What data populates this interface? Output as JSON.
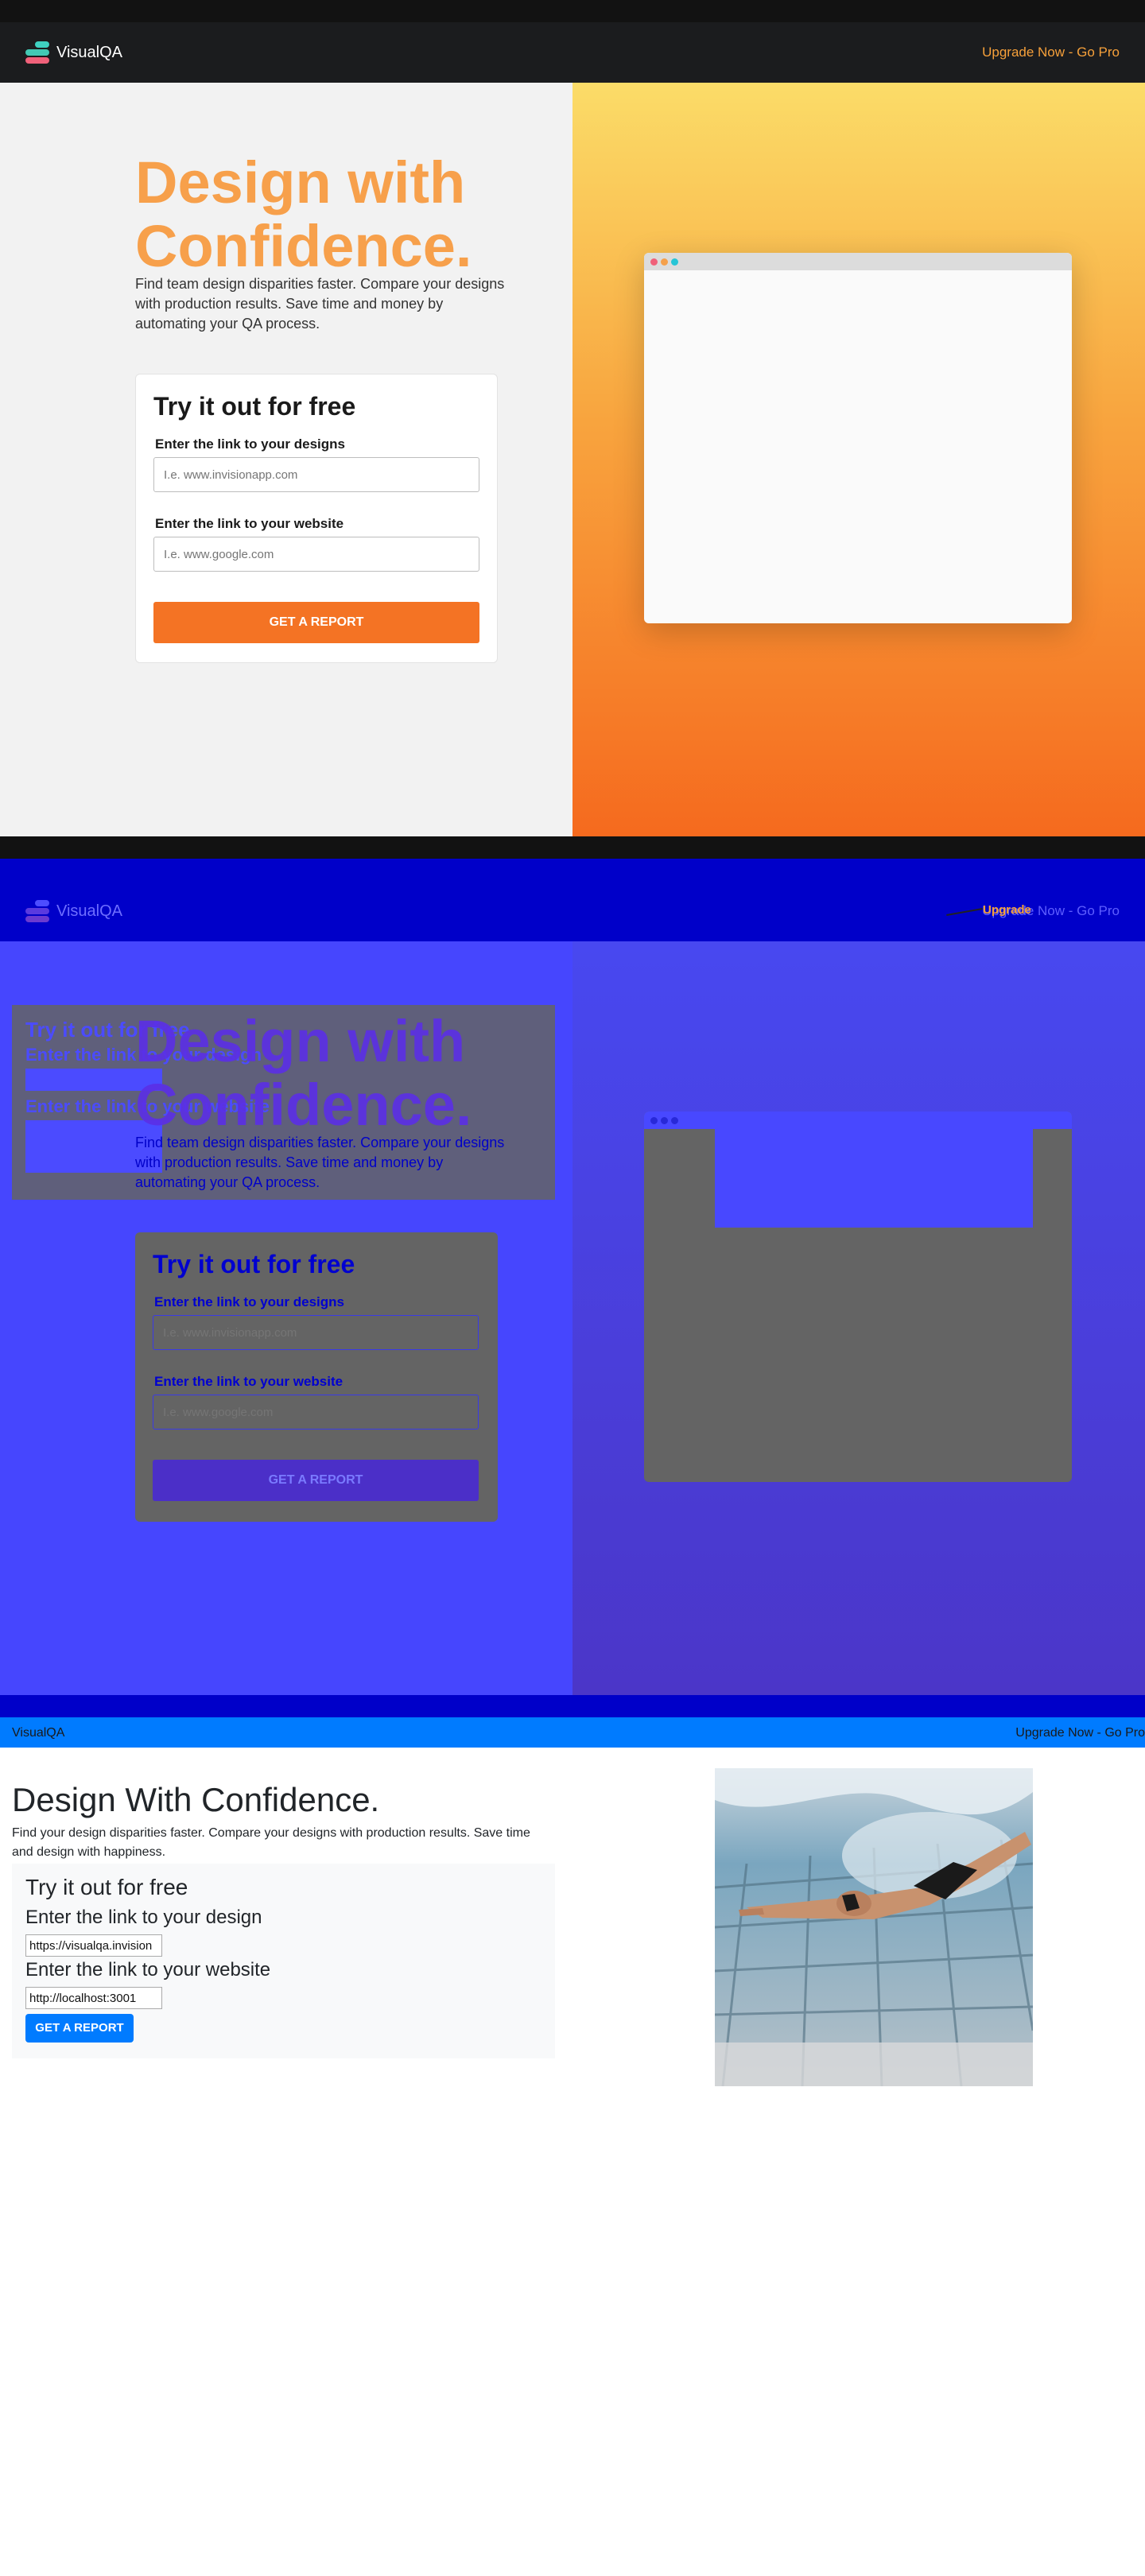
{
  "app": {
    "brand": "VisualQA",
    "upgrade": "Upgrade Now - Go Pro"
  },
  "design": {
    "headline_line1": "Design with",
    "headline_line2": "Confidence.",
    "subtitle": "Find team design disparities faster. Compare your designs with production results. Save time and money by automating your QA process.",
    "card_title": "Try it out for free",
    "label_design": "Enter the link to your designs",
    "placeholder_design": "I.e. www.invisionapp.com",
    "label_website": "Enter the link to your website",
    "placeholder_website": "I.e. www.google.com",
    "cta": "GET A REPORT"
  },
  "overlay": {
    "upgrade_short": "Upgrade",
    "ghost_card_title": "Try it out for free",
    "ghost_label_design": "Enter the link to your design",
    "ghost_label_website": "Enter the link to your website"
  },
  "website": {
    "brand": "VisualQA",
    "upgrade": "Upgrade Now - Go Pro",
    "headline": "Design With Confidence.",
    "subtitle": "Find your design disparities faster. Compare your designs with production results. Save time and design with happiness.",
    "card_title": "Try it out for free",
    "label_design": "Enter the link to your design",
    "value_design": "https://visualqa.invision",
    "label_website": "Enter the link to your website",
    "value_website": "http://localhost:3001",
    "cta": "GET A REPORT"
  },
  "colors": {
    "accent_orange": "#f47324",
    "diff_blue": "#0000c9",
    "bootstrap_blue": "#007bff"
  },
  "icons": {
    "logo": "stacked-layers-logo",
    "window_dots": [
      "red",
      "orange",
      "cyan"
    ]
  }
}
